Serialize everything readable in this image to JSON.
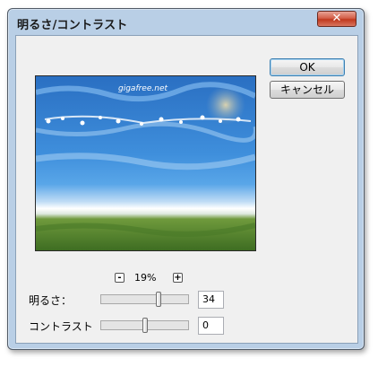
{
  "window": {
    "title": "明るさ/コントラスト",
    "close_glyph": "✕"
  },
  "buttons": {
    "ok_label": "OK",
    "cancel_label": "キャンセル"
  },
  "preview": {
    "watermark": "gigafree.net"
  },
  "zoom": {
    "minus_glyph": "-",
    "value": "19%",
    "plus_glyph": "+"
  },
  "adjustments": {
    "brightness": {
      "label": "明るさ：",
      "value": "34",
      "level": 0.67
    },
    "contrast": {
      "label": "コントラスト",
      "value": "0",
      "level": 0.5
    }
  },
  "colors": {
    "sky_top": "#2a6fc2",
    "sky_mid": "#59a6e8",
    "horizon": "#ffffff",
    "grass": "#5d8c32"
  }
}
